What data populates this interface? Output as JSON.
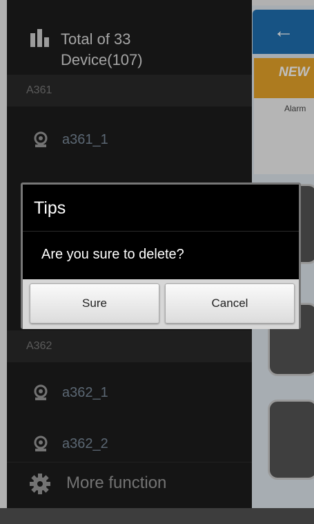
{
  "header": {
    "title_line1": "Total of 33",
    "title_line2": "Device(107)"
  },
  "groups": [
    {
      "name": "A361",
      "devices": [
        "a361_1"
      ]
    },
    {
      "name": "A362",
      "devices": [
        "a362_1",
        "a362_2"
      ]
    }
  ],
  "footer": {
    "more_label": "More function"
  },
  "dialog": {
    "title": "Tips",
    "message": "Are you sure to delete?",
    "sure": "Sure",
    "cancel": "Cancel"
  },
  "background": {
    "banner_text": "NEW",
    "promo_title": "Alarm"
  },
  "colors": {
    "drawer_bg": "#1d1d1d",
    "header_blue": "#1f6fb0",
    "banner_orange": "#e7a52a",
    "dialog_bg": "#000000"
  }
}
